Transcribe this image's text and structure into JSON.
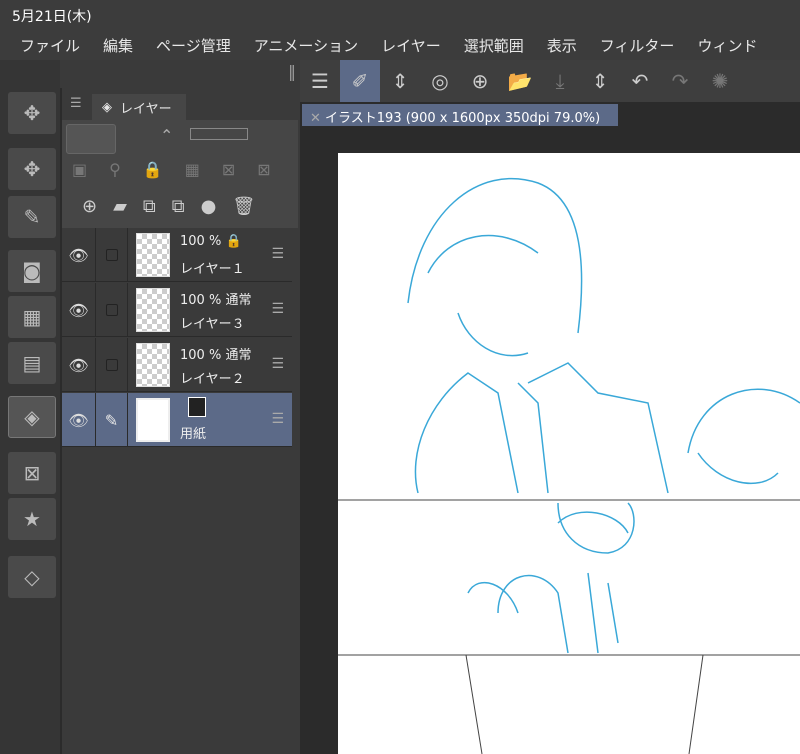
{
  "status": {
    "date": "5月21日(木)"
  },
  "menu": [
    "ファイル",
    "編集",
    "ページ管理",
    "アニメーション",
    "レイヤー",
    "選択範囲",
    "表示",
    "フィルター",
    "ウィンド"
  ],
  "doc_tab": {
    "title": "イラスト193 (900 x 1600px 350dpi 79.0%)"
  },
  "layer_panel": {
    "tab_label": "レイヤー",
    "layers": [
      {
        "opacity": "100 %",
        "blend": "",
        "name": "レイヤー１",
        "locked": true,
        "selected": false
      },
      {
        "opacity": "100 %",
        "blend": "通常",
        "name": "レイヤー３",
        "selected": false
      },
      {
        "opacity": "100 %",
        "blend": "通常",
        "name": "レイヤー２",
        "selected": false
      },
      {
        "opacity": "",
        "blend": "",
        "name": "用紙",
        "selected": true
      }
    ]
  },
  "colors": {
    "accent": "#5c6a88",
    "sketch": "#3aa8d8"
  }
}
